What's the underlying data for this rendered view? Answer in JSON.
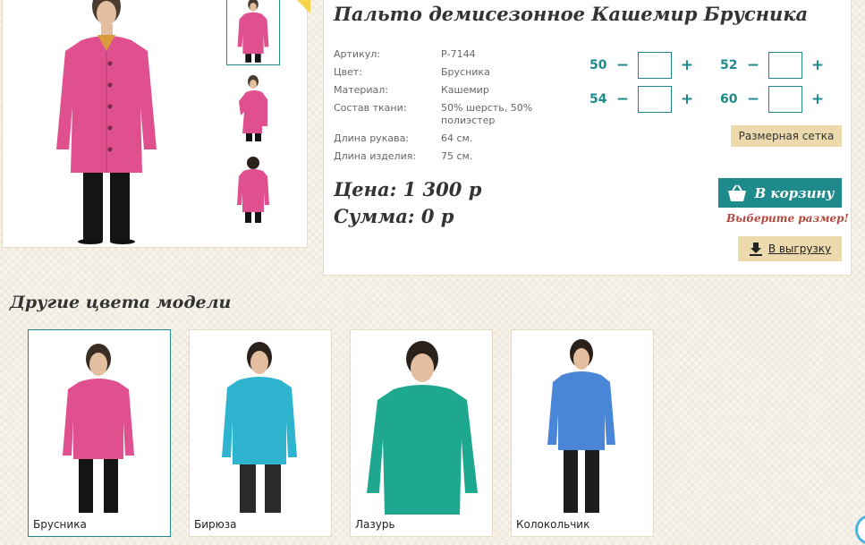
{
  "product": {
    "title": "Пальто демисезонное Кашемир Брусника",
    "specs": [
      {
        "label": "Артикул:",
        "value": "Р-7144"
      },
      {
        "label": "Цвет:",
        "value": "Брусника"
      },
      {
        "label": "Материал:",
        "value": "Кашемир"
      },
      {
        "label": "Состав ткани:",
        "value": "50% шерсть, 50% полиэстер"
      },
      {
        "label": "Длина рукава:",
        "value": "64 см."
      },
      {
        "label": "Длина изделия:",
        "value": "75 см."
      }
    ],
    "price": "Цена: 1 300 р",
    "sum": "Сумма: 0 р",
    "coat_color": "#e0508f"
  },
  "sizes": {
    "items": [
      {
        "size": "50",
        "minus": "−",
        "plus": "+",
        "qty": ""
      },
      {
        "size": "52",
        "minus": "−",
        "plus": "+",
        "qty": ""
      },
      {
        "size": "54",
        "minus": "−",
        "plus": "+",
        "qty": ""
      },
      {
        "size": "60",
        "minus": "−",
        "plus": "+",
        "qty": ""
      }
    ],
    "size_chart_label": "Размерная сетка"
  },
  "actions": {
    "cart_label": "В корзину",
    "cart_icon": "basket-icon",
    "warning": "Выберите размер!",
    "export_label": "В выгрузку",
    "export_icon": "download-icon"
  },
  "other_colors": {
    "heading": "Другие цвета модели",
    "items": [
      {
        "name": "Брусника",
        "color": "#e0508f",
        "selected": true
      },
      {
        "name": "Бирюза",
        "color": "#2fb4cf",
        "selected": false
      },
      {
        "name": "Лазурь",
        "color": "#1fa890",
        "selected": false
      },
      {
        "name": "Колокольчик",
        "color": "#4a86d8",
        "selected": false
      }
    ]
  },
  "theme": {
    "accent": "#1f8a8c",
    "button_beige": "#ecd9ac",
    "warning_red": "#b2483c"
  }
}
